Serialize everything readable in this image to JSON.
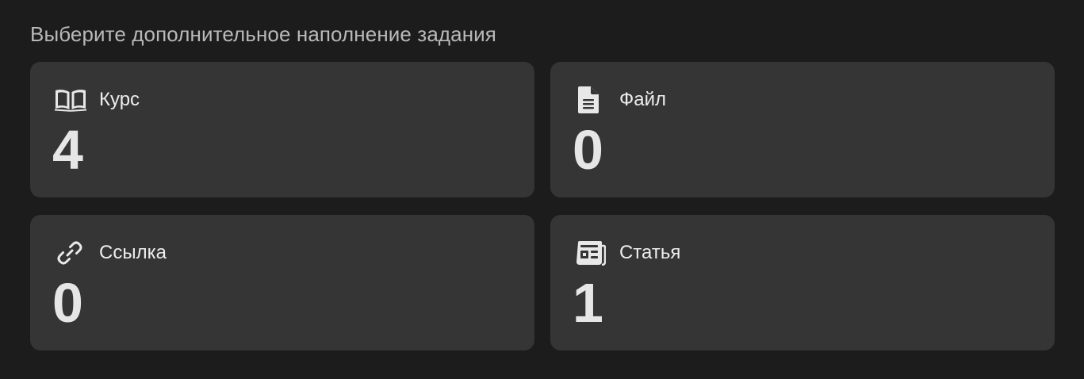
{
  "heading": "Выберите дополнительное наполнение задания",
  "cards": [
    {
      "label": "Курс",
      "count": "4",
      "icon": "book-open-icon"
    },
    {
      "label": "Файл",
      "count": "0",
      "icon": "file-icon"
    },
    {
      "label": "Ссылка",
      "count": "0",
      "icon": "link-icon"
    },
    {
      "label": "Статья",
      "count": "1",
      "icon": "newspaper-icon"
    }
  ],
  "colors": {
    "background": "#1c1c1c",
    "card": "#353535",
    "text": "#ededed",
    "muted": "#b9b9b9"
  }
}
